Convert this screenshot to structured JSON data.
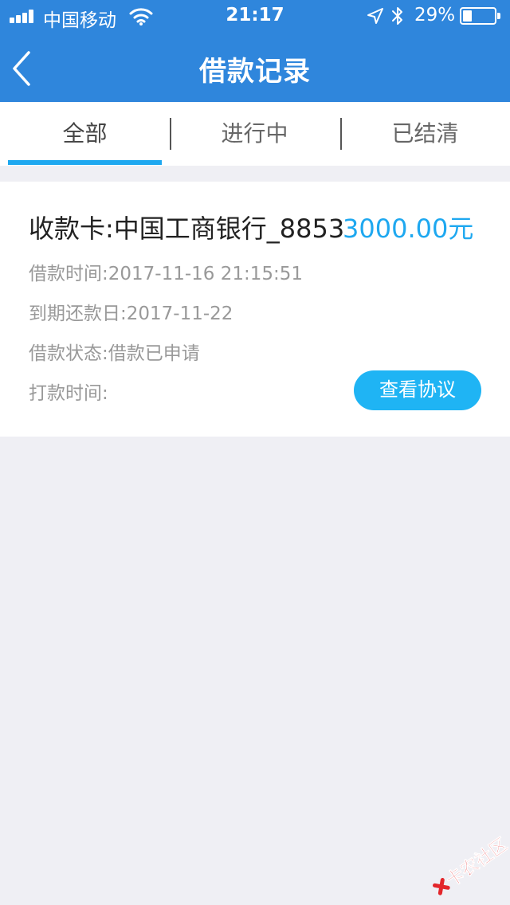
{
  "status_bar": {
    "carrier": "中国移动",
    "time": "21:17",
    "battery_percent": "29%",
    "battery_level": 0.29
  },
  "nav": {
    "title": "借款记录"
  },
  "tabs": [
    {
      "label": "全部",
      "active": true
    },
    {
      "label": "进行中",
      "active": false
    },
    {
      "label": "已结清",
      "active": false
    }
  ],
  "record": {
    "card_label": "收款卡:中国工商银行_8853",
    "amount": "3000.00元",
    "loan_time": "借款时间:2017-11-16 21:15:51",
    "due_date": "到期还款日:2017-11-22",
    "status": "借款状态:借款已申请",
    "payout_time": "打款时间:",
    "view_agreement": "查看协议"
  },
  "watermark": {
    "text": "卡农社区"
  },
  "colors": {
    "nav_bg": "#2f86dc",
    "accent": "#1ea8f0",
    "button_bg": "#1fb4f4",
    "page_bg": "#efeff4"
  },
  "icons": [
    "signal-icon",
    "wifi-icon",
    "location-icon",
    "bluetooth-icon",
    "battery-icon",
    "back-chevron-icon",
    "watermark-logo-icon"
  ]
}
